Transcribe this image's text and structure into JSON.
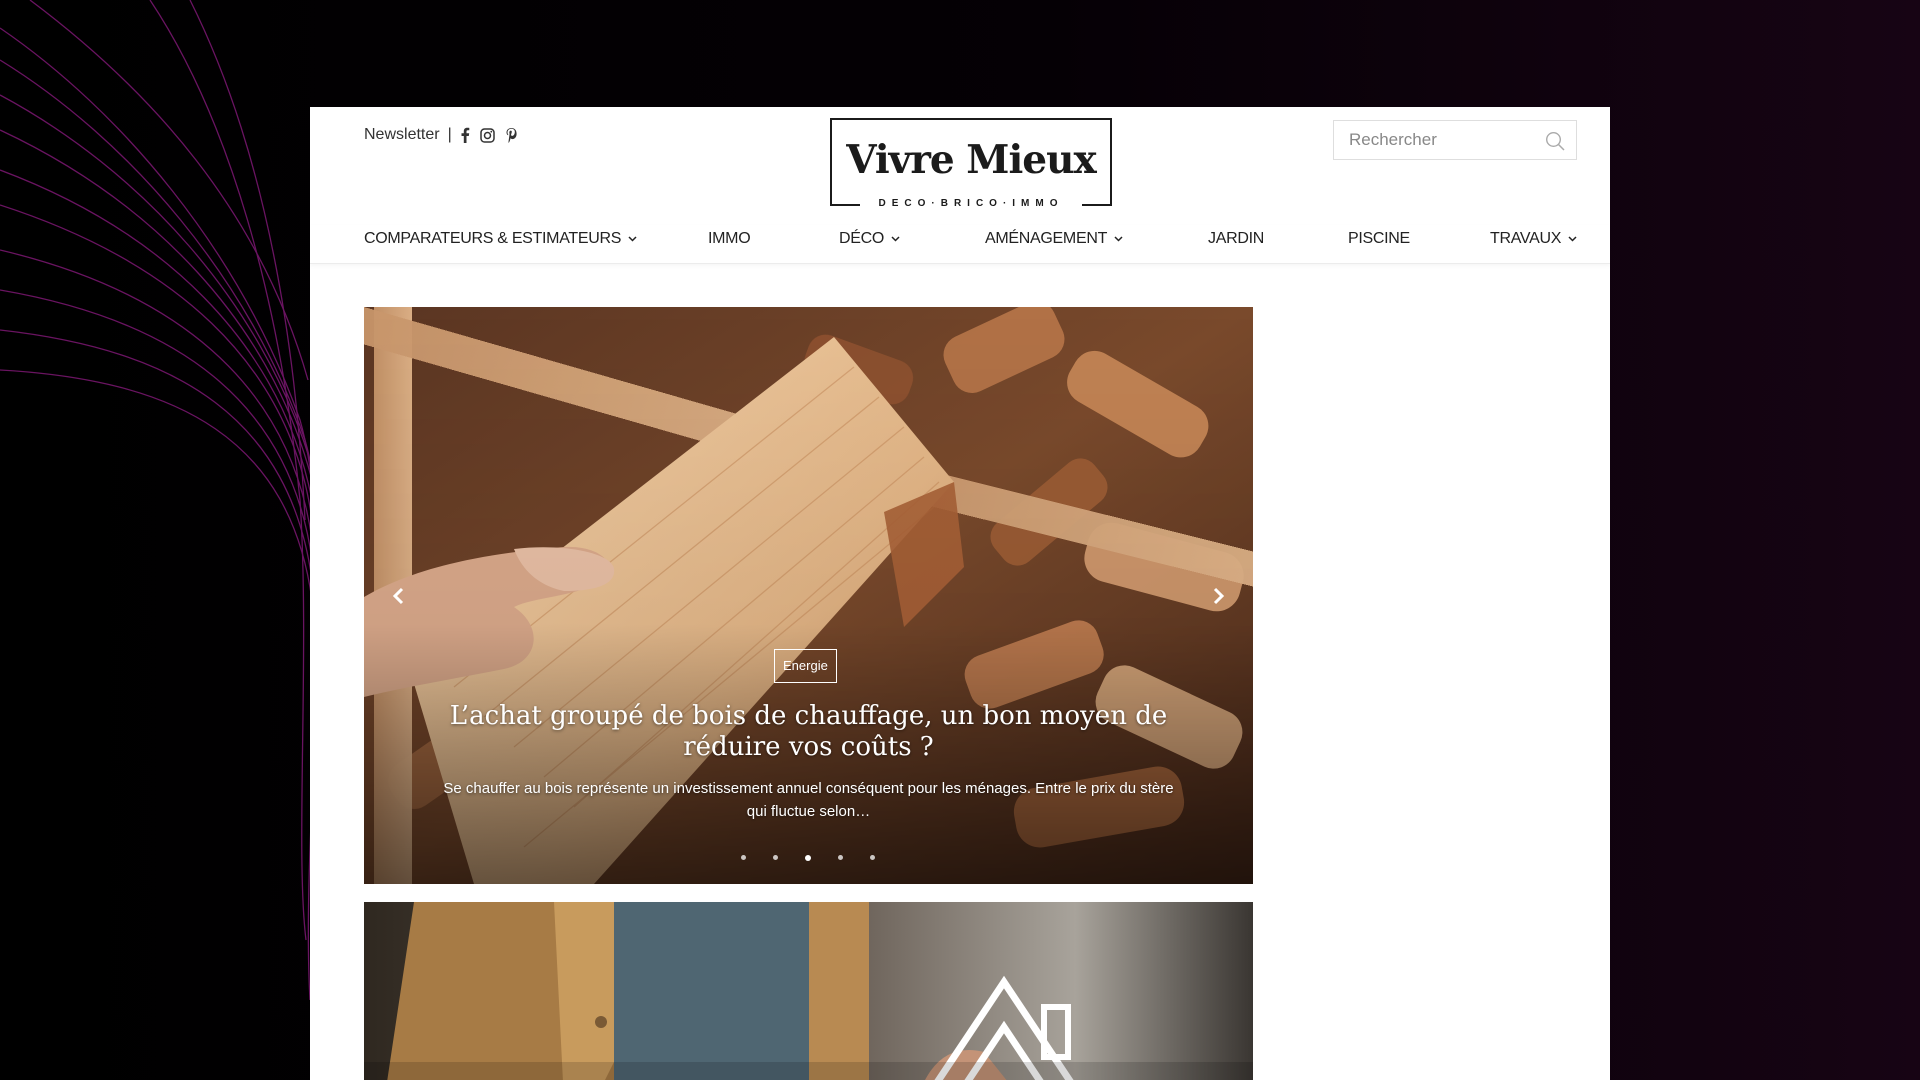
{
  "topbar": {
    "newsletter_label": "Newsletter",
    "separator": "|",
    "social_icons": [
      "facebook-icon",
      "instagram-icon",
      "pinterest-icon"
    ]
  },
  "logo": {
    "title": "Vivre Mieux",
    "subtitle": "DECO·BRICO·IMMO"
  },
  "search": {
    "placeholder": "Rechercher"
  },
  "nav": {
    "items": [
      {
        "label": "COMPARATEURS & ESTIMATEURS",
        "has_dropdown": true
      },
      {
        "label": "IMMO",
        "has_dropdown": false
      },
      {
        "label": "DÉCO",
        "has_dropdown": true
      },
      {
        "label": "AMÉNAGEMENT",
        "has_dropdown": true
      },
      {
        "label": "JARDIN",
        "has_dropdown": false
      },
      {
        "label": "PISCINE",
        "has_dropdown": false
      },
      {
        "label": "TRAVAUX",
        "has_dropdown": true
      }
    ]
  },
  "slider": {
    "category": "Energie",
    "title": "L’achat groupé de bois de chauffage, un bon moyen de réduire vos coûts ?",
    "excerpt": "Se chauffer au bois représente un investissement annuel conséquent pour les ménages. Entre le prix du stère qui fluctue selon…",
    "slide_count": 5,
    "active_slide_index": 2
  },
  "colors": {
    "accent_lines": "#8a1a7a",
    "text": "#222222",
    "page_bg": "#ffffff"
  }
}
